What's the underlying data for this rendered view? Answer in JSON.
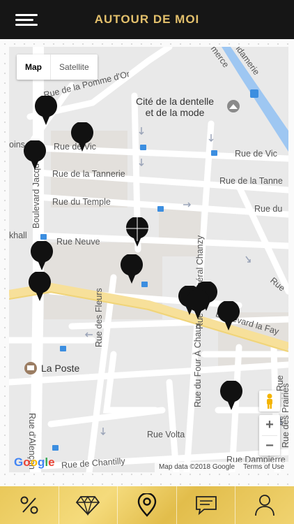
{
  "header": {
    "title": "AUTOUR DE MOI",
    "menu_icon": "hamburger-menu-icon"
  },
  "map": {
    "type_control": {
      "options": [
        "Map",
        "Satellite"
      ],
      "selected": "Map"
    },
    "streets": [
      "Rue de la Pomme d'Or",
      "Rue de Vic",
      "Rue de Vic",
      "Rue de la Tannerie",
      "Rue de la Tanne",
      "Rue du Temple",
      "Rue du",
      "Rue Neuve",
      "Boulevard Jacqu",
      "Rue du Général Chanzy",
      "Boulevard la Fay",
      "Rue des Fleurs",
      "Rue du Four À Chaux",
      "Rue d'Alençon",
      "Rue Volta",
      "Rue de Chantilly",
      "Rue Dampierre",
      "merce",
      "idamerie",
      "Rue",
      "Rue",
      "oins",
      "khall",
      "de",
      "Rue des Prairies"
    ],
    "pois": {
      "museum": "Cité de la dentelle\net de la mode",
      "post": "La Poste"
    },
    "zoom_in": "+",
    "zoom_out": "−",
    "google_logo": "Google",
    "attribution": {
      "data": "Map data ©2018 Google",
      "terms": "Terms of Use"
    }
  },
  "bottom_nav": {
    "tabs": [
      {
        "icon": "percent-icon"
      },
      {
        "icon": "diamond-icon"
      },
      {
        "icon": "location-pin-icon"
      },
      {
        "icon": "chat-icon"
      },
      {
        "icon": "user-icon"
      }
    ],
    "selected": "location-pin-icon"
  },
  "colors": {
    "header_bg": "#161616",
    "title": "#e3c06c",
    "gold": "#e9c85a",
    "pin": "#111111"
  }
}
